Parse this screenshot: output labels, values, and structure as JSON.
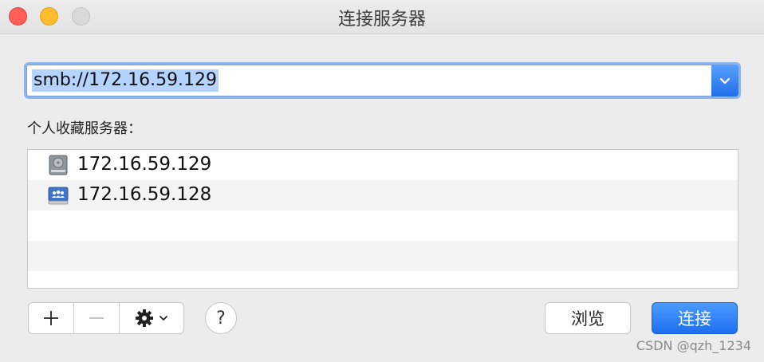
{
  "window": {
    "title": "连接服务器"
  },
  "address": {
    "value": "smb://172.16.59.129"
  },
  "favorites": {
    "label": "个人收藏服务器：",
    "items": [
      {
        "address": "172.16.59.129",
        "icon": "hard-drive-icon"
      },
      {
        "address": "172.16.59.128",
        "icon": "server-icon"
      }
    ]
  },
  "toolbar": {
    "add_label": "+",
    "remove_label": "—",
    "help_label": "?"
  },
  "buttons": {
    "browse": "浏览",
    "connect": "连接"
  },
  "watermark": "CSDN @qzh_1234",
  "colors": {
    "accent": "#1d6ff0",
    "selection": "#b5d3ff"
  }
}
